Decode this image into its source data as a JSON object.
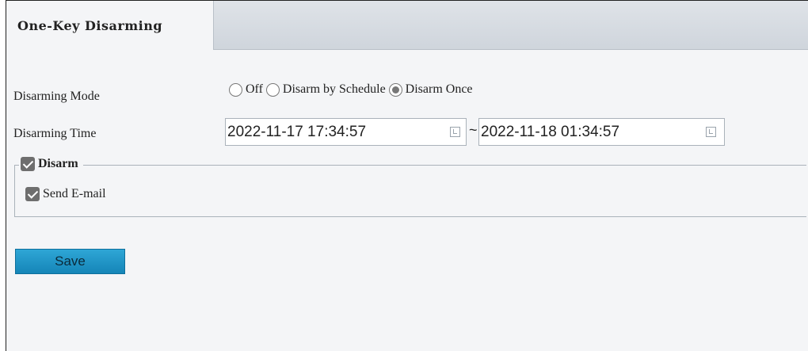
{
  "tab": {
    "label": "One-Key Disarming"
  },
  "disarming_mode": {
    "label": "Disarming Mode",
    "options": [
      {
        "label": "Off",
        "checked": false
      },
      {
        "label": "Disarm by Schedule",
        "checked": false
      },
      {
        "label": "Disarm Once",
        "checked": true
      }
    ]
  },
  "disarming_time": {
    "label": "Disarming Time",
    "start": "2022-11-17 17:34:57",
    "separator": "~",
    "end": "2022-11-18 01:34:57"
  },
  "disarm_group": {
    "label": "Disarm",
    "checked": true,
    "send_email": {
      "label": "Send E-mail",
      "checked": true
    }
  },
  "save_button": {
    "label": "Save"
  }
}
